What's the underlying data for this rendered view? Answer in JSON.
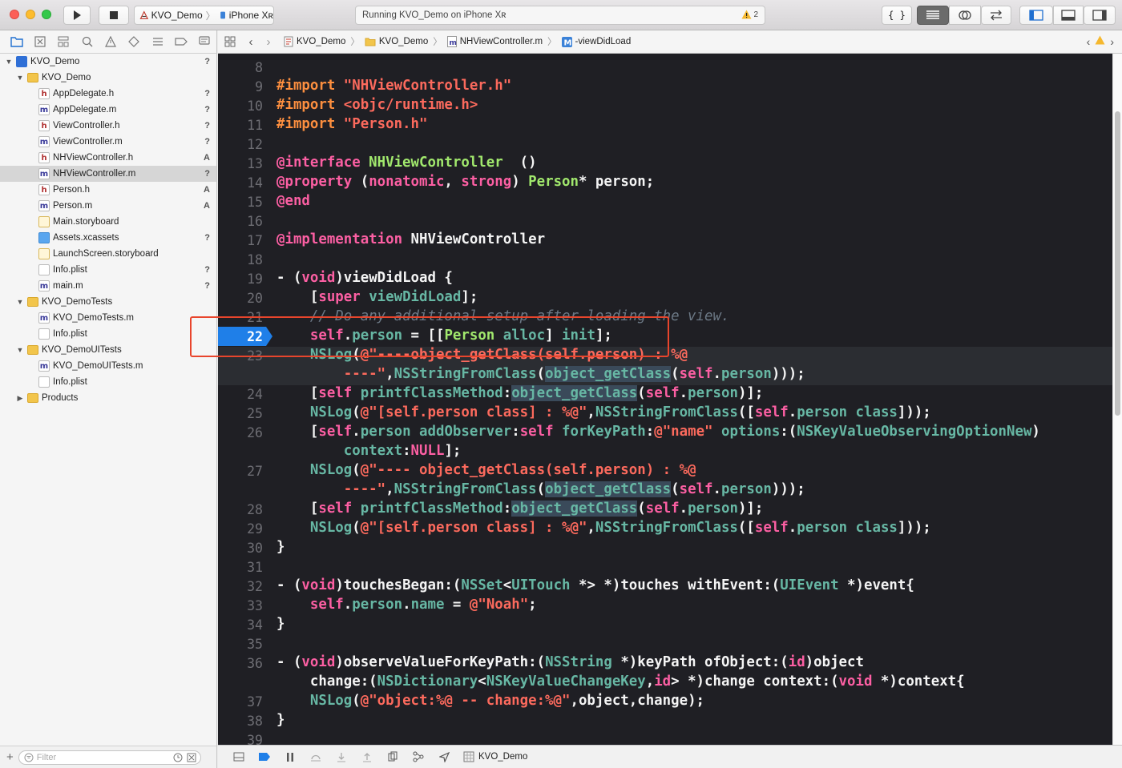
{
  "toolbar": {
    "scheme_project": "KVO_Demo",
    "scheme_device": "iPhone Xʀ",
    "activity_text": "Running KVO_Demo on iPhone Xʀ",
    "warning_count": "2",
    "editor_code_label": "{ }"
  },
  "navigator": {
    "items": [
      {
        "indent": 0,
        "disc": "▼",
        "icon": "project",
        "label": "KVO_Demo",
        "badge": "?",
        "selected": false
      },
      {
        "indent": 1,
        "disc": "▼",
        "icon": "folder",
        "label": "KVO_Demo",
        "badge": "",
        "selected": false
      },
      {
        "indent": 2,
        "disc": "",
        "icon": "h",
        "label": "AppDelegate.h",
        "badge": "?",
        "selected": false
      },
      {
        "indent": 2,
        "disc": "",
        "icon": "m",
        "label": "AppDelegate.m",
        "badge": "?",
        "selected": false
      },
      {
        "indent": 2,
        "disc": "",
        "icon": "h",
        "label": "ViewController.h",
        "badge": "?",
        "selected": false
      },
      {
        "indent": 2,
        "disc": "",
        "icon": "m",
        "label": "ViewController.m",
        "badge": "?",
        "selected": false
      },
      {
        "indent": 2,
        "disc": "",
        "icon": "h",
        "label": "NHViewController.h",
        "badge": "A",
        "selected": false
      },
      {
        "indent": 2,
        "disc": "",
        "icon": "m",
        "label": "NHViewController.m",
        "badge": "?",
        "selected": true
      },
      {
        "indent": 2,
        "disc": "",
        "icon": "h",
        "label": "Person.h",
        "badge": "A",
        "selected": false
      },
      {
        "indent": 2,
        "disc": "",
        "icon": "m",
        "label": "Person.m",
        "badge": "A",
        "selected": false
      },
      {
        "indent": 2,
        "disc": "",
        "icon": "sb",
        "label": "Main.storyboard",
        "badge": "",
        "selected": false
      },
      {
        "indent": 2,
        "disc": "",
        "icon": "xc",
        "label": "Assets.xcassets",
        "badge": "?",
        "selected": false
      },
      {
        "indent": 2,
        "disc": "",
        "icon": "sb",
        "label": "LaunchScreen.storyboard",
        "badge": "",
        "selected": false
      },
      {
        "indent": 2,
        "disc": "",
        "icon": "pl",
        "label": "Info.plist",
        "badge": "?",
        "selected": false
      },
      {
        "indent": 2,
        "disc": "",
        "icon": "m",
        "label": "main.m",
        "badge": "?",
        "selected": false
      },
      {
        "indent": 1,
        "disc": "▼",
        "icon": "folder",
        "label": "KVO_DemoTests",
        "badge": "",
        "selected": false
      },
      {
        "indent": 2,
        "disc": "",
        "icon": "m",
        "label": "KVO_DemoTests.m",
        "badge": "",
        "selected": false
      },
      {
        "indent": 2,
        "disc": "",
        "icon": "pl",
        "label": "Info.plist",
        "badge": "",
        "selected": false
      },
      {
        "indent": 1,
        "disc": "▼",
        "icon": "folder",
        "label": "KVO_DemoUITests",
        "badge": "",
        "selected": false
      },
      {
        "indent": 2,
        "disc": "",
        "icon": "m",
        "label": "KVO_DemoUITests.m",
        "badge": "",
        "selected": false
      },
      {
        "indent": 2,
        "disc": "",
        "icon": "pl",
        "label": "Info.plist",
        "badge": "",
        "selected": false
      },
      {
        "indent": 1,
        "disc": "▶",
        "icon": "folder",
        "label": "Products",
        "badge": "",
        "selected": false
      }
    ],
    "filter_placeholder": "Filter"
  },
  "jumpbar": {
    "crumbs": [
      "KVO_Demo",
      "KVO_Demo",
      "NHViewController.m",
      "-viewDidLoad"
    ]
  },
  "editor": {
    "breakpoint_line": "22",
    "lines": [
      {
        "n": "8",
        "tokens": []
      },
      {
        "n": "9",
        "tokens": [
          [
            "pre",
            "#import "
          ],
          [
            "str",
            "\"NHViewController.h\""
          ]
        ]
      },
      {
        "n": "10",
        "tokens": [
          [
            "pre",
            "#import "
          ],
          [
            "str",
            "<objc/runtime.h>"
          ]
        ]
      },
      {
        "n": "11",
        "tokens": [
          [
            "pre",
            "#import "
          ],
          [
            "str",
            "\"Person.h\""
          ]
        ]
      },
      {
        "n": "12",
        "tokens": []
      },
      {
        "n": "13",
        "tokens": [
          [
            "kw",
            "@interface "
          ],
          [
            "cls",
            "NHViewController"
          ],
          [
            "",
            "  ()"
          ]
        ]
      },
      {
        "n": "14",
        "tokens": [
          [
            "kw",
            "@property "
          ],
          [
            "",
            "("
          ],
          [
            "kw",
            "nonatomic"
          ],
          [
            "",
            ", "
          ],
          [
            "kw",
            "strong"
          ],
          [
            "",
            ") "
          ],
          [
            "cls",
            "Person"
          ],
          [
            "",
            "* person;"
          ]
        ]
      },
      {
        "n": "15",
        "tokens": [
          [
            "kw",
            "@end"
          ]
        ]
      },
      {
        "n": "16",
        "tokens": []
      },
      {
        "n": "17",
        "tokens": [
          [
            "kw",
            "@implementation "
          ],
          [
            "",
            "NHViewController"
          ]
        ]
      },
      {
        "n": "18",
        "tokens": []
      },
      {
        "n": "19",
        "tokens": [
          [
            "",
            "- ("
          ],
          [
            "kw",
            "void"
          ],
          [
            "",
            ")viewDidLoad {"
          ]
        ]
      },
      {
        "n": "20",
        "tokens": [
          [
            "",
            "    ["
          ],
          [
            "kw",
            "super"
          ],
          [
            "",
            ""
          ],
          [
            "fn",
            " viewDidLoad"
          ],
          [
            "",
            "];"
          ]
        ]
      },
      {
        "n": "21",
        "tokens": [
          [
            "cm",
            "    // Do any additional setup after loading the view."
          ]
        ]
      },
      {
        "n": "22",
        "tokens": [
          [
            "kw",
            "    self"
          ],
          [
            "",
            "."
          ],
          [
            "fn",
            "person"
          ],
          [
            "",
            " = [["
          ],
          [
            "cls",
            "Person"
          ],
          [
            "fn",
            " alloc"
          ],
          [
            "",
            "] "
          ],
          [
            "fn",
            "init"
          ],
          [
            "",
            "];"
          ]
        ]
      },
      {
        "n": "23",
        "tokens": [
          [
            "fn",
            "    NSLog"
          ],
          [
            "",
            "("
          ],
          [
            "str",
            "@\"----object_getClass(self.person) : %@"
          ]
        ]
      },
      {
        "n": "",
        "tokens": [
          [
            "str",
            "        ----\""
          ],
          [
            "",
            ","
          ],
          [
            "fn",
            "NSStringFromClass"
          ],
          [
            "",
            "("
          ],
          [
            "fntok",
            "object_getClass"
          ],
          [
            "",
            "("
          ],
          [
            "kw",
            "self"
          ],
          [
            "",
            "."
          ],
          [
            "fn",
            "person"
          ],
          [
            "",
            ")));"
          ]
        ]
      },
      {
        "n": "24",
        "tokens": [
          [
            "",
            "    ["
          ],
          [
            "kw",
            "self"
          ],
          [
            "fn",
            " printfClassMethod"
          ],
          [
            "",
            ":"
          ],
          [
            "fntok",
            "object_getClass"
          ],
          [
            "",
            "("
          ],
          [
            "kw",
            "self"
          ],
          [
            "",
            "."
          ],
          [
            "fn",
            "person"
          ],
          [
            "",
            ")];"
          ]
        ]
      },
      {
        "n": "25",
        "tokens": [
          [
            "fn",
            "    NSLog"
          ],
          [
            "",
            "("
          ],
          [
            "str",
            "@\"[self.person class] : %@\""
          ],
          [
            "",
            ","
          ],
          [
            "fn",
            "NSStringFromClass"
          ],
          [
            "",
            "(["
          ],
          [
            "kw",
            "self"
          ],
          [
            "",
            "."
          ],
          [
            "fn",
            "person"
          ],
          [
            "fn",
            " class"
          ],
          [
            "",
            "]));"
          ]
        ]
      },
      {
        "n": "26",
        "tokens": [
          [
            "",
            "    ["
          ],
          [
            "kw",
            "self"
          ],
          [
            "",
            "."
          ],
          [
            "fn",
            "person"
          ],
          [
            "fn",
            " addObserver"
          ],
          [
            "",
            ":"
          ],
          [
            "kw",
            "self"
          ],
          [
            "fn",
            " forKeyPath"
          ],
          [
            "",
            ":"
          ],
          [
            "str",
            "@\"name\""
          ],
          [
            "fn",
            " options"
          ],
          [
            "",
            ":("
          ],
          [
            "fn",
            "NSKeyValueObservingOptionNew"
          ],
          [
            "",
            ")"
          ]
        ]
      },
      {
        "n": "",
        "tokens": [
          [
            "fn",
            "        context"
          ],
          [
            "",
            ":"
          ],
          [
            "kw",
            "NULL"
          ],
          [
            "",
            "];"
          ]
        ]
      },
      {
        "n": "27",
        "tokens": [
          [
            "fn",
            "    NSLog"
          ],
          [
            "",
            "("
          ],
          [
            "str",
            "@\"---- object_getClass(self.person) : %@"
          ]
        ]
      },
      {
        "n": "",
        "tokens": [
          [
            "str",
            "        ----\""
          ],
          [
            "",
            ","
          ],
          [
            "fn",
            "NSStringFromClass"
          ],
          [
            "",
            "("
          ],
          [
            "fntok",
            "object_getClass"
          ],
          [
            "",
            "("
          ],
          [
            "kw",
            "self"
          ],
          [
            "",
            "."
          ],
          [
            "fn",
            "person"
          ],
          [
            "",
            ")));"
          ]
        ]
      },
      {
        "n": "28",
        "tokens": [
          [
            "",
            "    ["
          ],
          [
            "kw",
            "self"
          ],
          [
            "fn",
            " printfClassMethod"
          ],
          [
            "",
            ":"
          ],
          [
            "fntok",
            "object_getClass"
          ],
          [
            "",
            "("
          ],
          [
            "kw",
            "self"
          ],
          [
            "",
            "."
          ],
          [
            "fn",
            "person"
          ],
          [
            "",
            ")];"
          ]
        ]
      },
      {
        "n": "29",
        "tokens": [
          [
            "fn",
            "    NSLog"
          ],
          [
            "",
            "("
          ],
          [
            "str",
            "@\"[self.person class] : %@\""
          ],
          [
            "",
            ","
          ],
          [
            "fn",
            "NSStringFromClass"
          ],
          [
            "",
            "(["
          ],
          [
            "kw",
            "self"
          ],
          [
            "",
            "."
          ],
          [
            "fn",
            "person"
          ],
          [
            "fn",
            " class"
          ],
          [
            "",
            "]));"
          ]
        ]
      },
      {
        "n": "30",
        "tokens": [
          [
            "",
            "}"
          ]
        ]
      },
      {
        "n": "31",
        "tokens": []
      },
      {
        "n": "32",
        "tokens": [
          [
            "",
            "- ("
          ],
          [
            "kw",
            "void"
          ],
          [
            "",
            ")touchesBegan:("
          ],
          [
            "fn",
            "NSSet"
          ],
          [
            "",
            "<"
          ],
          [
            "fn",
            "UITouch"
          ],
          [
            "",
            " *> *)touches withEvent:("
          ],
          [
            "fn",
            "UIEvent"
          ],
          [
            "",
            " *)event{"
          ]
        ]
      },
      {
        "n": "33",
        "tokens": [
          [
            "kw",
            "    self"
          ],
          [
            "",
            "."
          ],
          [
            "fn",
            "person"
          ],
          [
            "",
            "."
          ],
          [
            "fn",
            "name"
          ],
          [
            "",
            " = "
          ],
          [
            "str",
            "@\"Noah\""
          ],
          [
            "",
            ";"
          ]
        ]
      },
      {
        "n": "34",
        "tokens": [
          [
            "",
            "}"
          ]
        ]
      },
      {
        "n": "35",
        "tokens": []
      },
      {
        "n": "36",
        "tokens": [
          [
            "",
            "- ("
          ],
          [
            "kw",
            "void"
          ],
          [
            "",
            ")observeValueForKeyPath:("
          ],
          [
            "fn",
            "NSString"
          ],
          [
            "",
            " *)keyPath ofObject:("
          ],
          [
            "kw",
            "id"
          ],
          [
            "",
            ")object"
          ]
        ]
      },
      {
        "n": "",
        "tokens": [
          [
            "",
            "    change:("
          ],
          [
            "fn",
            "NSDictionary"
          ],
          [
            "",
            "<"
          ],
          [
            "fn",
            "NSKeyValueChangeKey"
          ],
          [
            "",
            ","
          ],
          [
            "kw",
            "id"
          ],
          [
            "",
            "> *)change context:("
          ],
          [
            "kw",
            "void"
          ],
          [
            "",
            " *)context{"
          ]
        ]
      },
      {
        "n": "37",
        "tokens": [
          [
            "fn",
            "    NSLog"
          ],
          [
            "",
            "("
          ],
          [
            "str",
            "@\"object:%@ -- change:%@\""
          ],
          [
            "",
            ",object,change);"
          ]
        ]
      },
      {
        "n": "38",
        "tokens": [
          [
            "",
            "}"
          ]
        ]
      },
      {
        "n": "39",
        "tokens": []
      }
    ]
  },
  "debugbar": {
    "target_label": "KVO_Demo"
  },
  "colors": {
    "editor_bg": "#1f1f24",
    "keyword": "#fc5fa3",
    "string": "#fc6a5d",
    "class": "#a1e86d",
    "function": "#67b7a4",
    "comment": "#6c7986",
    "preprocessor": "#fd8f3f",
    "breakpoint": "#1f7fe8",
    "annotation_box": "#e8452c"
  }
}
